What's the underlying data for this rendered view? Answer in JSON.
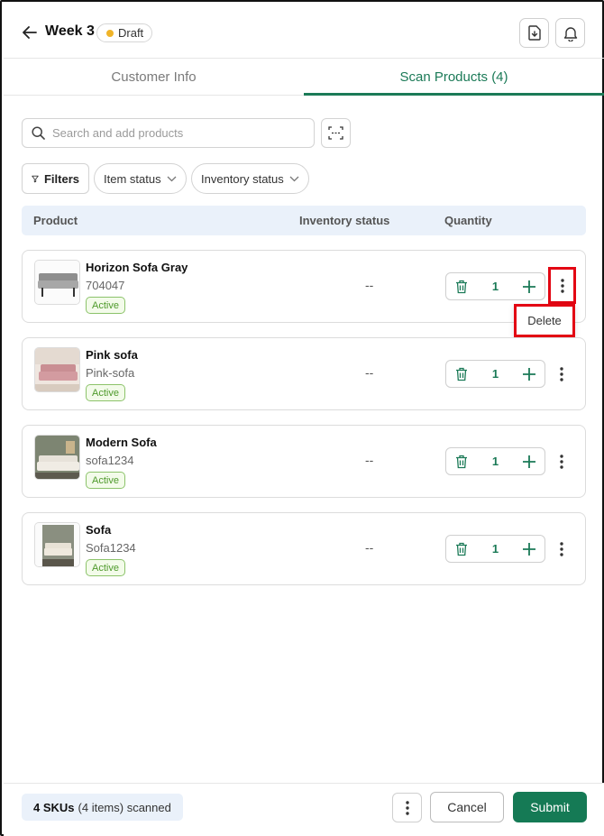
{
  "header": {
    "title": "Week 3",
    "status_badge": "Draft",
    "icons": [
      "arrow-left-icon",
      "download-file-icon",
      "bell-icon"
    ]
  },
  "tabs": [
    {
      "label": "Customer Info",
      "active": false
    },
    {
      "label": "Scan Products (4)",
      "active": true
    }
  ],
  "search": {
    "placeholder": "Search and add products"
  },
  "filters": {
    "filters_label": "Filters",
    "item_status_label": "Item status",
    "inventory_status_label": "Inventory status"
  },
  "table": {
    "columns": [
      "Product",
      "Inventory status",
      "Quantity"
    ]
  },
  "products": [
    {
      "name": "Horizon Sofa Gray",
      "sku": "704047",
      "status": "Active",
      "inventory": "--",
      "quantity": "1"
    },
    {
      "name": "Pink sofa",
      "sku": "Pink-sofa",
      "status": "Active",
      "inventory": "--",
      "quantity": "1"
    },
    {
      "name": "Modern Sofa",
      "sku": "sofa1234",
      "status": "Active",
      "inventory": "--",
      "quantity": "1"
    },
    {
      "name": "Sofa",
      "sku": "Sofa1234",
      "status": "Active",
      "inventory": "--",
      "quantity": "1"
    }
  ],
  "context_menu": {
    "delete_label": "Delete"
  },
  "footer": {
    "skus_count": "4 SKUs",
    "summary_rest": "(4 items) scanned",
    "cancel_label": "Cancel",
    "submit_label": "Submit"
  },
  "colors": {
    "accent": "#1b7a57",
    "submit_bg": "#157a55",
    "draft_dot": "#f0b429",
    "highlight": "#e30613",
    "table_head_bg": "#eaf1fa",
    "active_badge": "#4e9a2b"
  }
}
